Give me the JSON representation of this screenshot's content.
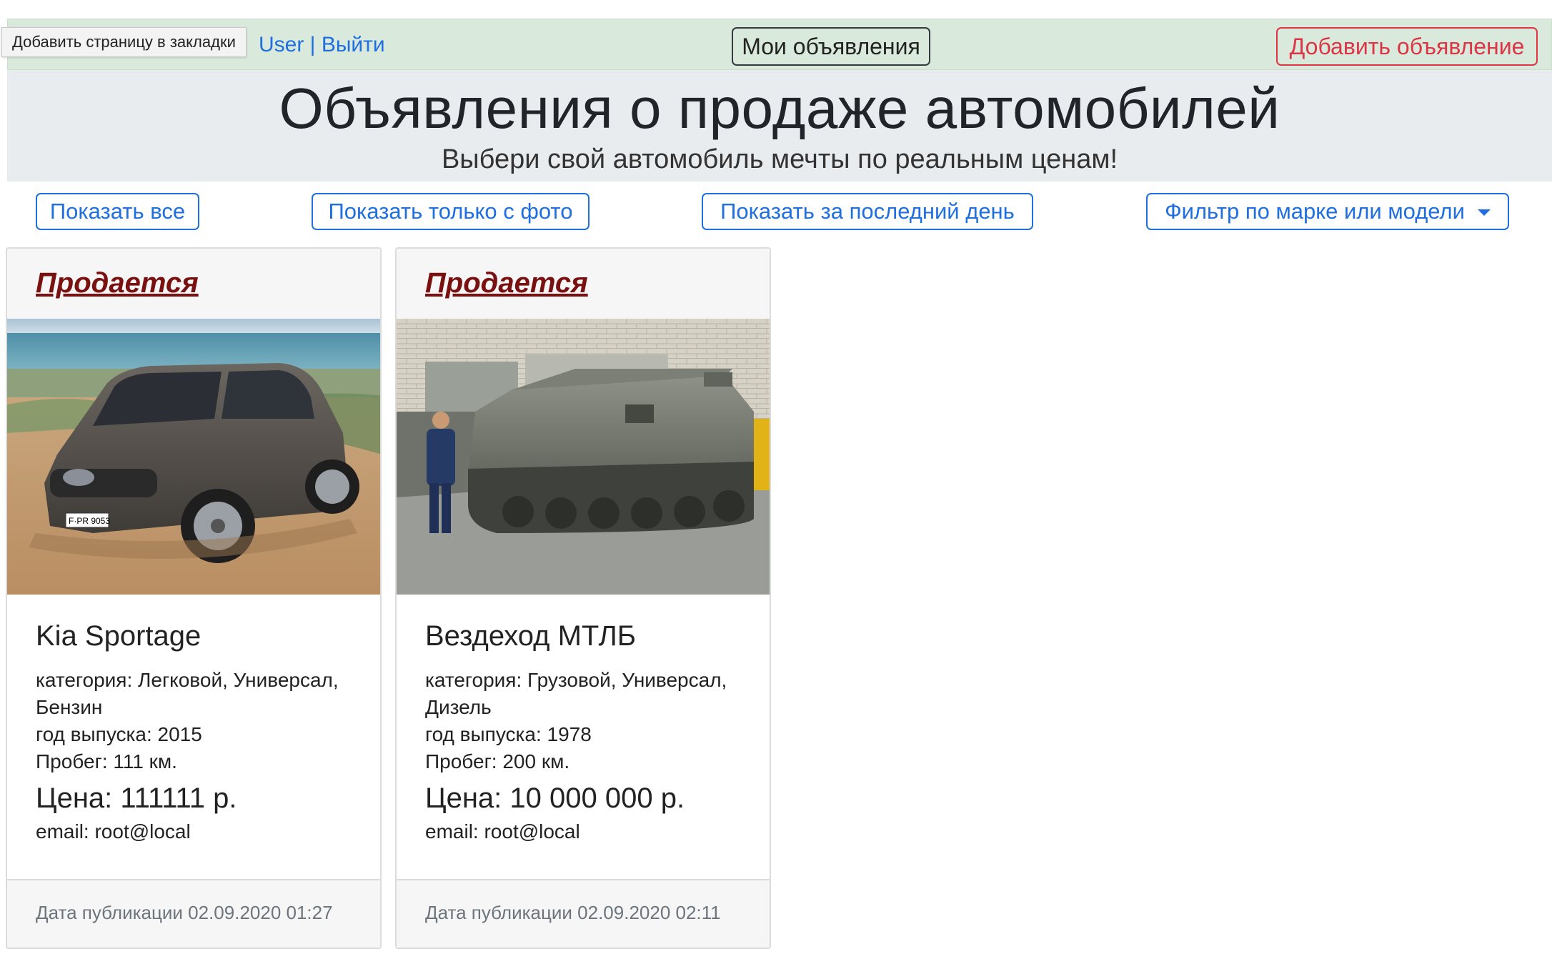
{
  "tooltip": "Добавить страницу в закладки",
  "topbar": {
    "user_partial": "User",
    "separator": " | ",
    "logout": "Выйти",
    "my_ads": "Мои объявления",
    "add_ad": "Добавить объявление"
  },
  "jumbotron": {
    "title": "Объявления о продаже автомобилей",
    "subtitle": "Выбери свой автомобиль мечты по реальным ценам!"
  },
  "filters": {
    "show_all": "Показать все",
    "photo_only": "Показать только с фото",
    "last_day": "Показать за последний день",
    "brand_filter": "Фильтр по марке или модели"
  },
  "cards": [
    {
      "status": "Продается",
      "title": "Kia Sportage",
      "category": "категория: Легковой, Универсал,",
      "category_cont": "Бензин",
      "year": "год выпуска: 2015",
      "mileage": "Пробег: 111 км.",
      "price": "Цена: 111111 р.",
      "email": "email: root@local",
      "date": "Дата публикации 02.09.2020 01:27",
      "plate": "F·PR 9053"
    },
    {
      "status": "Продается",
      "title": "Вездеход МТЛБ",
      "category": "категория: Грузовой, Универсал,",
      "category_cont": "Дизель",
      "year": "год выпуска: 1978",
      "mileage": "Пробег: 200 км.",
      "price": "Цена: 10 000 000 р.",
      "email": "email: root@local",
      "date": "Дата публикации 02.09.2020 02:11"
    }
  ],
  "colors": {
    "topbar_bg": "#d9e9db",
    "primary": "#1f6fe0",
    "danger": "#dc3545",
    "status_link": "#7a1111"
  }
}
